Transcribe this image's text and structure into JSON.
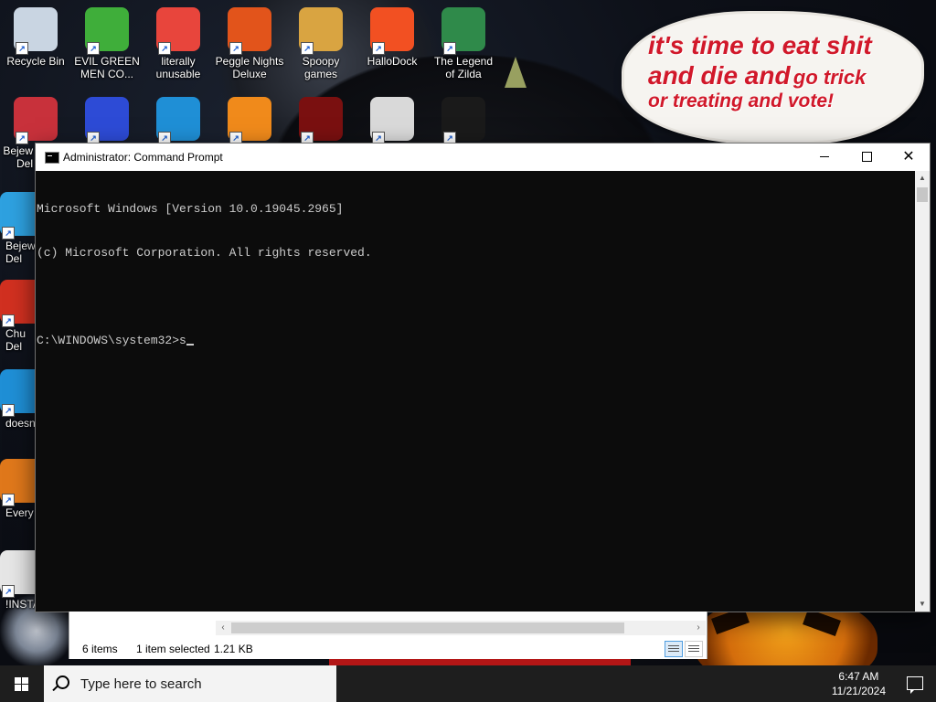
{
  "wallpaper": {
    "sticker_text": {
      "line1": "it's time to eat shit",
      "line2a": "and die and",
      "line2b": "go trick",
      "line3": "or treating and vote!"
    }
  },
  "desktop": {
    "icons_row1": [
      {
        "label": "Recycle Bin",
        "icon": "recycle-bin-icon",
        "color": "#c9d5e2"
      },
      {
        "label": "EVIL GREEN\nMEN CO...",
        "icon": "green-men-icon",
        "color": "#3fae3a"
      },
      {
        "label": "literally\nunusable",
        "icon": "chrome-icon",
        "color": "#e8453c"
      },
      {
        "label": "Peggle Nights\nDeluxe",
        "icon": "peggle-icon",
        "color": "#e2541b"
      },
      {
        "label": "Spoopy\ngames",
        "icon": "folder-icon",
        "color": "#d9a441"
      },
      {
        "label": "HalloDock",
        "icon": "windows-shield-icon",
        "color": "#f25022"
      },
      {
        "label": "The Legend\nof Zilda",
        "icon": "zilda-icon",
        "color": "#2f8a4a"
      }
    ],
    "icons_row2": [
      {
        "label": "",
        "icon": "bejeweled-icon",
        "color": "#c8313b"
      },
      {
        "label": "",
        "icon": "mpl-icon",
        "color": "#2d4bd6"
      },
      {
        "label": "",
        "icon": "edge-icon",
        "color": "#1f8fd6"
      },
      {
        "label": "",
        "icon": "peggle-icon",
        "color": "#f08a1b"
      },
      {
        "label": "",
        "icon": "flash-icon",
        "color": "#7a1010"
      },
      {
        "label": "",
        "icon": "network-shield-icon",
        "color": "#d9d9d9"
      },
      {
        "label": "",
        "icon": "yashma-icon",
        "color": "#1a1a1a"
      }
    ],
    "icons_left": [
      {
        "label": "Bejew\nDel",
        "icon": "bejeweled-icon",
        "color": "#2ea1e0"
      },
      {
        "label": "Chu\nDel",
        "icon": "chuzzle-icon",
        "color": "#d13020"
      },
      {
        "label": "doesn",
        "icon": "edge-icon",
        "color": "#1f8fd6"
      },
      {
        "label": "Every",
        "icon": "app-icon",
        "color": "#e0781b"
      },
      {
        "label": "!INSTA",
        "icon": "file-icon",
        "color": "#e6e6e6"
      }
    ],
    "left_top_label": "Bejew\nDel"
  },
  "cmd": {
    "title": "Administrator: Command Prompt",
    "lines": [
      "Microsoft Windows [Version 10.0.19045.2965]",
      "(c) Microsoft Corporation. All rights reserved.",
      "",
      "C:\\WINDOWS\\system32>s"
    ],
    "minimize_glyph": "",
    "close_glyph": "✕"
  },
  "explorer": {
    "item_count": "6 items",
    "selection": "1 item selected",
    "size": "1.21 KB"
  },
  "taskbar": {
    "search_placeholder": "Type here to search",
    "time": "6:47 AM",
    "date": "11/21/2024"
  }
}
